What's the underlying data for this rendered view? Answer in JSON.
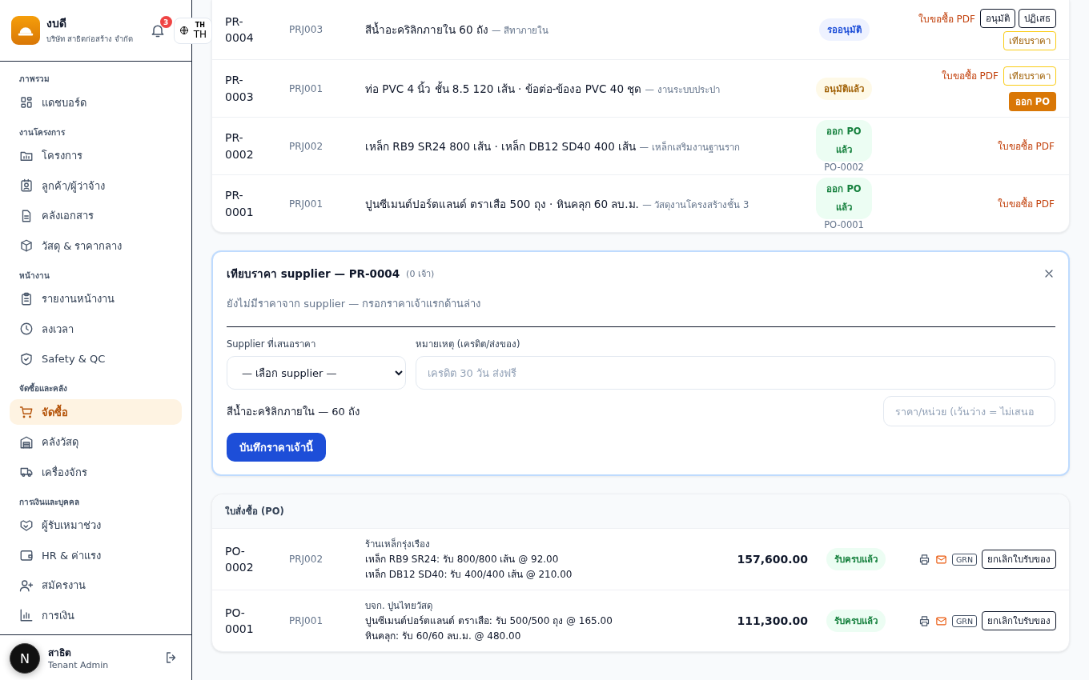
{
  "sidebar": {
    "brand": {
      "name": "งบดี",
      "company": "บริษัท สาธิตก่อสร้าง จำกัด"
    },
    "notifications": {
      "count": "3"
    },
    "language": {
      "small": "TH",
      "code": "TH"
    },
    "sections": [
      {
        "title": "ภาพรวม",
        "items": [
          {
            "label": "แดชบอร์ด",
            "selected": false
          }
        ]
      },
      {
        "title": "งานโครงการ",
        "items": [
          {
            "label": "โครงการ",
            "selected": false
          },
          {
            "label": "ลูกค้า/ผู้ว่าจ้าง",
            "selected": false
          },
          {
            "label": "คลังเอกสาร",
            "selected": false
          },
          {
            "label": "วัสดุ & ราคากลาง",
            "selected": false
          }
        ]
      },
      {
        "title": "หน้างาน",
        "items": [
          {
            "label": "รายงานหน้างาน",
            "selected": false
          },
          {
            "label": "ลงเวลา",
            "selected": false
          },
          {
            "label": "Safety & QC",
            "selected": false
          }
        ]
      },
      {
        "title": "จัดซื้อและคลัง",
        "items": [
          {
            "label": "จัดซื้อ",
            "selected": true
          },
          {
            "label": "คลังวัสดุ",
            "selected": false
          },
          {
            "label": "เครื่องจักร",
            "selected": false
          }
        ]
      },
      {
        "title": "การเงินและบุคคล",
        "items": [
          {
            "label": "ผู้รับเหมาช่วง",
            "selected": false
          },
          {
            "label": "HR & ค่าแรง",
            "selected": false
          },
          {
            "label": "สมัครงาน",
            "selected": false
          },
          {
            "label": "การเงิน",
            "selected": false
          }
        ]
      }
    ],
    "user": {
      "name": "สาธิต",
      "role": "Tenant Admin"
    },
    "dev_badge": "N"
  },
  "requests": [
    {
      "id": "PR-0004",
      "project": "PRJ003",
      "title": "สีน้ำอะคริลิกภายใน 60 ถัง",
      "note": "— สีทาภายใน",
      "status": {
        "kind": "pending",
        "label": "รออนุมัติ"
      },
      "actions": [
        {
          "kind": "link",
          "label": "ใบขอซื้อ PDF"
        },
        {
          "kind": "outline",
          "label": "อนุมัติ"
        },
        {
          "kind": "outline",
          "label": "ปฏิเสธ"
        },
        {
          "kind": "warn",
          "label": "เทียบราคา"
        }
      ]
    },
    {
      "id": "PR-0003",
      "project": "PRJ001",
      "title": "ท่อ PVC 4 นิ้ว ชั้น 8.5 120 เส้น · ข้อต่อ-ข้องอ PVC 40 ชุด",
      "note": "— งานระบบประปา",
      "status": {
        "kind": "approved",
        "label": "อนุมัติแล้ว"
      },
      "actions": [
        {
          "kind": "link",
          "label": "ใบขอซื้อ PDF"
        },
        {
          "kind": "warn",
          "label": "เทียบราคา"
        },
        {
          "kind": "primary",
          "label": "ออก PO"
        }
      ]
    },
    {
      "id": "PR-0002",
      "project": "PRJ002",
      "title": "เหล็ก RB9 SR24 800 เส้น · เหล็ก DB12 SD40 400 เส้น",
      "note": "— เหล็กเสริมงานฐานราก",
      "status": {
        "kind": "issued",
        "label": "ออก PO แล้ว",
        "ref": "PO-0002"
      },
      "actions": [
        {
          "kind": "link",
          "label": "ใบขอซื้อ PDF"
        }
      ]
    },
    {
      "id": "PR-0001",
      "project": "PRJ001",
      "title": "ปูนซีเมนต์ปอร์ตแลนด์ ตราเสือ 500 ถุง · หินคลุก 60 ลบ.ม.",
      "note": "— วัสดุงานโครงสร้างชั้น 3",
      "status": {
        "kind": "issued",
        "label": "ออก PO แล้ว",
        "ref": "PO-0001"
      },
      "actions": [
        {
          "kind": "link",
          "label": "ใบขอซื้อ PDF"
        }
      ]
    }
  ],
  "comparison": {
    "title": "เทียบราคา supplier — PR-0004",
    "count": "(0 เจ้า)",
    "empty_message": "ยังไม่มีราคาจาก supplier — กรอกราคาเจ้าแรกด้านล่าง",
    "supplier_label": "Supplier ที่เสนอราคา",
    "supplier_value": "— เลือก supplier —",
    "note_label": "หมายเหตุ (เครดิต/ส่งของ)",
    "note_placeholder": "เครดิต 30 วัน ส่งฟรี",
    "item": "สีน้ำอะคริลิกภายใน — 60 ถัง",
    "price_placeholder": "ราคา/หน่วย (เว้นว่าง = ไม่เสนอ",
    "save": "บันทึกราคาเจ้านี้"
  },
  "orders": {
    "title": "ใบสั่งซื้อ (PO)",
    "rows": [
      {
        "id": "PO-0002",
        "project": "PRJ002",
        "supplier": "ร้านเหล็กรุ่งเรือง",
        "lines": [
          "เหล็ก RB9 SR24: รับ 800/800 เส้น @ 92.00",
          "เหล็ก DB12 SD40: รับ 400/400 เส้น @ 210.00"
        ],
        "amount": "157,600.00",
        "status": {
          "kind": "received",
          "label": "รับครบแล้ว"
        },
        "grn": "GRN",
        "cancel": "ยกเลิกใบรับของ"
      },
      {
        "id": "PO-0001",
        "project": "PRJ001",
        "supplier": "บจก. ปูนไทยวัสดุ",
        "lines": [
          "ปูนซีเมนต์ปอร์ตแลนด์ ตราเสือ: รับ 500/500 ถุง @ 165.00",
          "หินคลุก: รับ 60/60 ลบ.ม. @ 480.00"
        ],
        "amount": "111,300.00",
        "status": {
          "kind": "received",
          "label": "รับครบแล้ว"
        },
        "grn": "GRN",
        "cancel": "ยกเลิกใบรับของ"
      }
    ]
  }
}
